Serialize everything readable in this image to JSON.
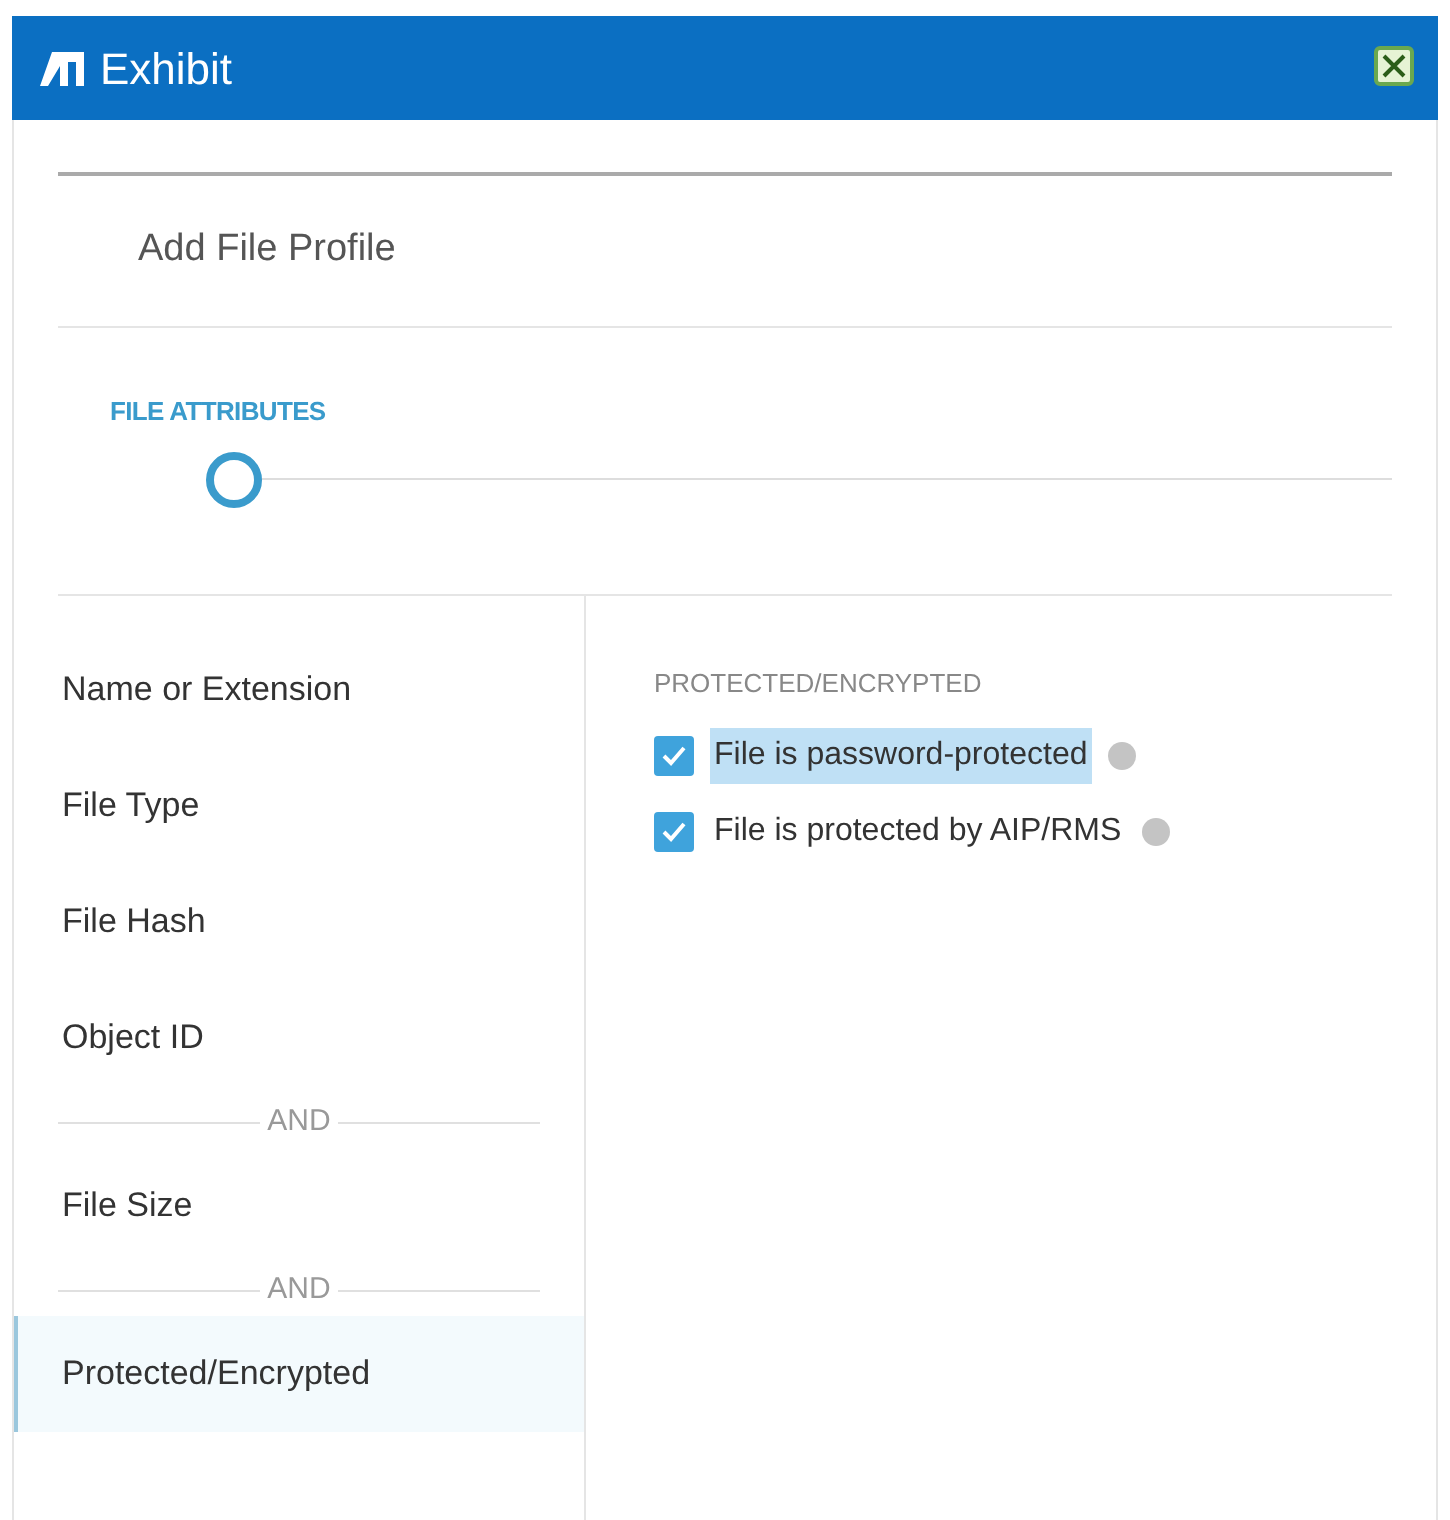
{
  "window": {
    "title": "Exhibit"
  },
  "page_title": "Add File Profile",
  "step": {
    "label": "FILE ATTRIBUTES",
    "selected": true
  },
  "sidebar": {
    "items": [
      {
        "kind": "item",
        "label": "Name or Extension",
        "selected": false
      },
      {
        "kind": "item",
        "label": "File Type",
        "selected": false
      },
      {
        "kind": "item",
        "label": "File Hash",
        "selected": false
      },
      {
        "kind": "item",
        "label": "Object ID",
        "selected": false
      },
      {
        "kind": "separator",
        "label": "AND"
      },
      {
        "kind": "item",
        "label": "File Size",
        "selected": false
      },
      {
        "kind": "separator",
        "label": "AND"
      },
      {
        "kind": "item",
        "label": "Protected/Encrypted",
        "selected": true
      }
    ]
  },
  "panel": {
    "heading": "PROTECTED/ENCRYPTED",
    "options": [
      {
        "label": "File is password-protected",
        "checked": true,
        "selected": true
      },
      {
        "label": "File is protected by AIP/RMS",
        "checked": true,
        "selected": false
      }
    ]
  }
}
